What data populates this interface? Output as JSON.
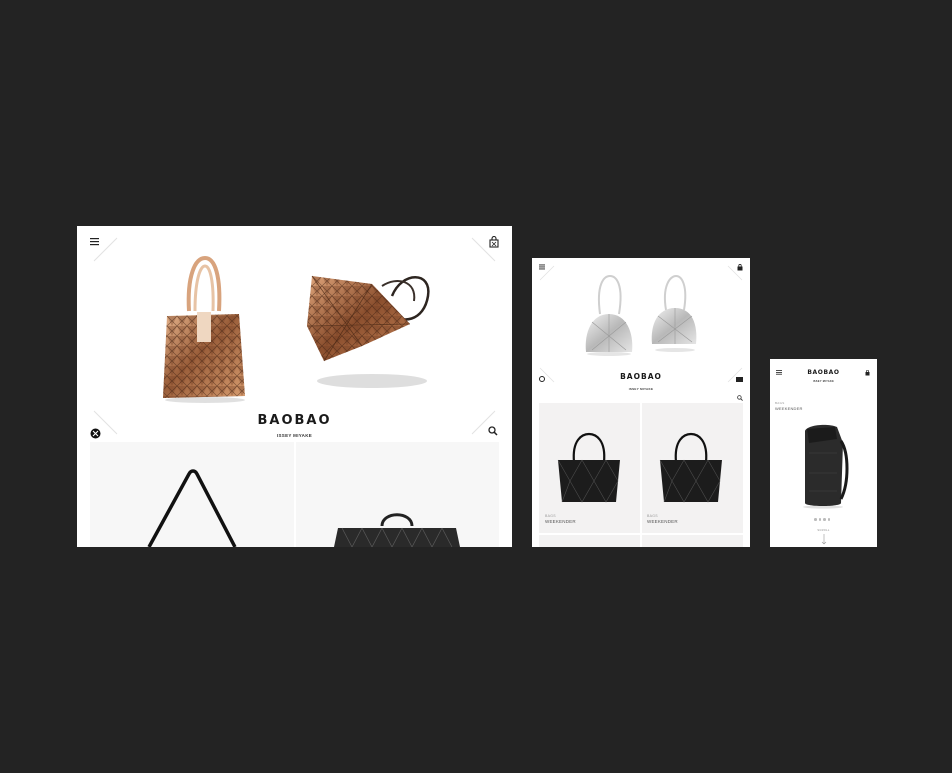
{
  "brand": {
    "logo": "BAOBAO",
    "sub": "ISSEY MIYAKE"
  },
  "desktop": {
    "menu_icon": "hamburger-menu-icon",
    "bag_icon": "shopping-bag-icon",
    "close_icon": "close-icon",
    "search_icon": "search-icon"
  },
  "tablet": {
    "products": [
      {
        "category": "BAGS",
        "name": "WEEKENDER"
      },
      {
        "category": "BAGS",
        "name": "WEEKENDER"
      }
    ]
  },
  "mobile": {
    "product": {
      "category": "BAGS",
      "name": "WEEKENDER"
    },
    "action": "SCROLL"
  },
  "colors": {
    "background": "#232323",
    "panel": "#f5f4f4",
    "bronze": "#b97a52"
  }
}
